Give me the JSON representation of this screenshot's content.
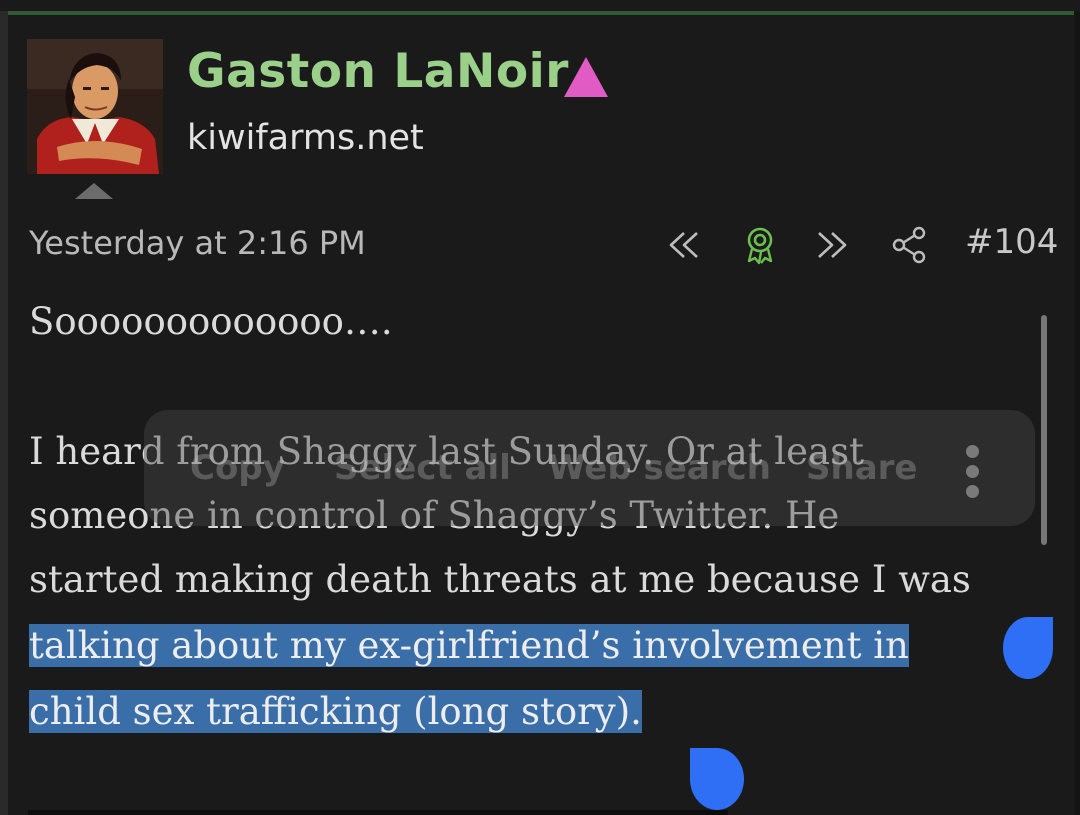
{
  "post": {
    "username": "Gaston LaNoir",
    "site": "kiwifarms.net",
    "timestamp": "Yesterday at 2:16 PM",
    "post_number": "#104",
    "badge_color": "#e05bc4"
  },
  "actions": {
    "icons": [
      "rewind-icon",
      "award-icon",
      "fast-forward-icon",
      "share-icon"
    ]
  },
  "content": {
    "line1": "Sooooooooooooo….",
    "line2a": "I heard from Shaggy last Sunday. Or at least",
    "line3a": "someone in control of Shaggy’s Twitter. He",
    "line4": "started making death threats at me because I was",
    "line5": "talking about my ex-girlfriend’s involvement in",
    "line6": "child sex trafficking (long story)."
  },
  "context_menu": {
    "items": [
      "Copy",
      "Select all",
      "Web search",
      "Share"
    ]
  },
  "colors": {
    "background": "#1a1a1a",
    "username": "#9bd08a",
    "highlight": "#3a6ea8",
    "selection_handle": "#2f6ff6",
    "award_icon": "#6cbf4f"
  }
}
